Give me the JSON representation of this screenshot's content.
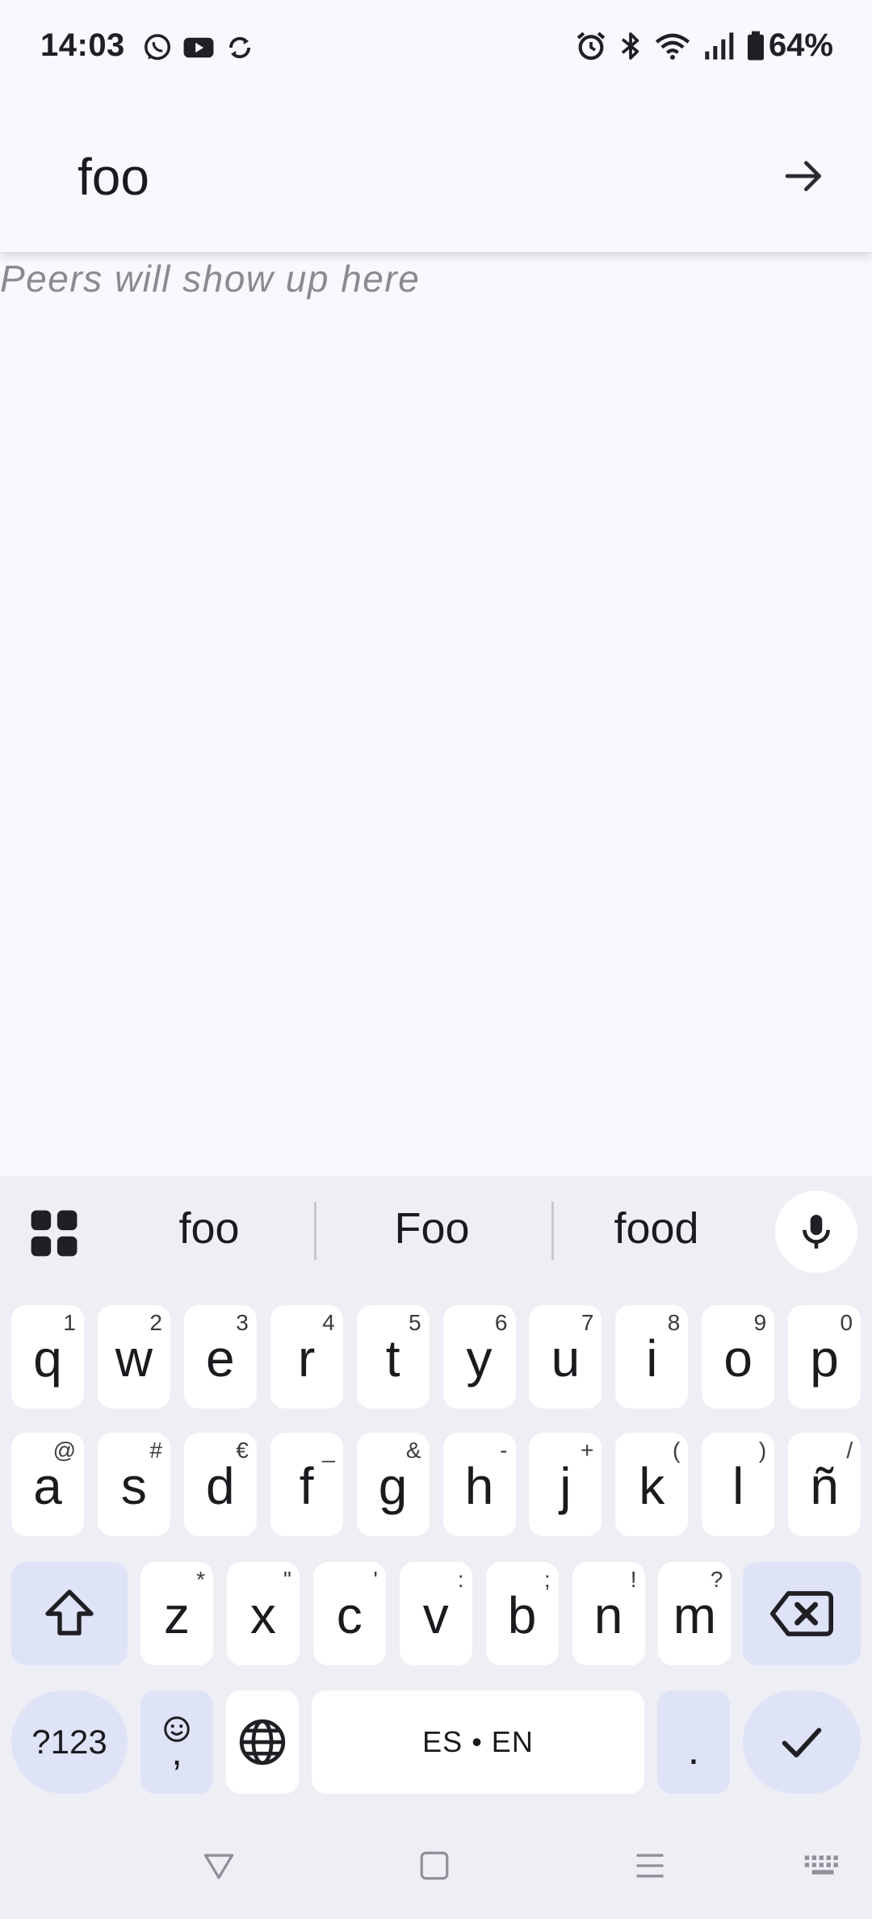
{
  "status_bar": {
    "time": "14:03",
    "left_icons": [
      "whatsapp-icon",
      "youtube-icon",
      "sync-icon"
    ],
    "right_icons": [
      "alarm-icon",
      "bluetooth-icon",
      "wifi-icon",
      "signal-icon",
      "battery-icon"
    ],
    "battery": "64%"
  },
  "header": {
    "input_value": "foo",
    "go_icon": "arrow-right-icon"
  },
  "main": {
    "empty_text": "Peers will show up here"
  },
  "keyboard": {
    "suggestions": [
      "foo",
      "Foo",
      "food"
    ],
    "row1": [
      {
        "k": "q",
        "h": "1"
      },
      {
        "k": "w",
        "h": "2"
      },
      {
        "k": "e",
        "h": "3"
      },
      {
        "k": "r",
        "h": "4"
      },
      {
        "k": "t",
        "h": "5"
      },
      {
        "k": "y",
        "h": "6"
      },
      {
        "k": "u",
        "h": "7"
      },
      {
        "k": "i",
        "h": "8"
      },
      {
        "k": "o",
        "h": "9"
      },
      {
        "k": "p",
        "h": "0"
      }
    ],
    "row2": [
      {
        "k": "a",
        "h": "@"
      },
      {
        "k": "s",
        "h": "#"
      },
      {
        "k": "d",
        "h": "€"
      },
      {
        "k": "f",
        "h": "_"
      },
      {
        "k": "g",
        "h": "&"
      },
      {
        "k": "h",
        "h": "-"
      },
      {
        "k": "j",
        "h": "+"
      },
      {
        "k": "k",
        "h": "("
      },
      {
        "k": "l",
        "h": ")"
      },
      {
        "k": "ñ",
        "h": "/"
      }
    ],
    "row3": [
      {
        "k": "z",
        "h": "*"
      },
      {
        "k": "x",
        "h": "\""
      },
      {
        "k": "c",
        "h": "'"
      },
      {
        "k": "v",
        "h": ":"
      },
      {
        "k": "b",
        "h": ";"
      },
      {
        "k": "n",
        "h": "!"
      },
      {
        "k": "m",
        "h": "?"
      }
    ],
    "symbols_label": "?123",
    "emoji_comma_label": ",",
    "space_label": "ES • EN",
    "period_label": ".",
    "icons": {
      "apps": "grid-icon",
      "mic": "microphone-icon",
      "shift": "shift-icon",
      "backspace": "backspace-icon",
      "emoji": "emoji-icon",
      "globe": "globe-icon",
      "enter": "check-icon"
    }
  },
  "navbar": {
    "icons": [
      "back-triangle-icon",
      "home-square-icon",
      "recents-menu-icon",
      "keyboard-switch-icon"
    ]
  }
}
